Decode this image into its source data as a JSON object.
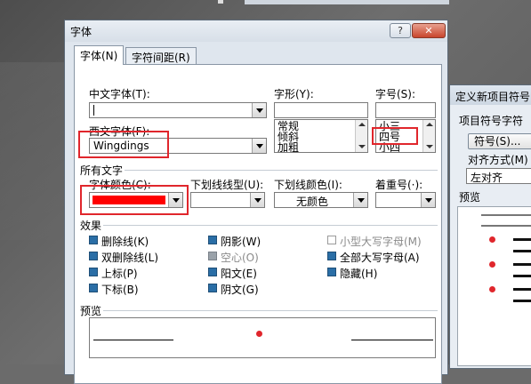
{
  "font_dialog": {
    "title": "字体",
    "buttons": {
      "help": "?",
      "close": "✕"
    },
    "tabs": [
      {
        "label": "字体(N)"
      },
      {
        "label": "字符间距(R)"
      }
    ],
    "chinese_font": {
      "label": "中文字体(T):",
      "value": ""
    },
    "western_font": {
      "label": "西文字体(F):",
      "value": "Wingdings"
    },
    "style": {
      "label": "字形(Y):",
      "value": "",
      "options": [
        "常规",
        "倾斜",
        "加粗"
      ]
    },
    "size": {
      "label": "字号(S):",
      "value": "",
      "options": [
        "小三",
        "四号",
        "小四"
      ]
    },
    "all_text": {
      "heading": "所有文字",
      "font_color": {
        "label": "字体颜色(C):",
        "color": "#ff0000"
      },
      "underline_style": {
        "label": "下划线线型(U):",
        "value": ""
      },
      "underline_color": {
        "label": "下划线颜色(I):",
        "value": "无颜色"
      },
      "emphasis": {
        "label": "着重号(·):",
        "value": ""
      }
    },
    "effects": {
      "heading": "效果",
      "items": [
        {
          "label": "删除线(K)"
        },
        {
          "label": "双删除线(L)"
        },
        {
          "label": "上标(P)"
        },
        {
          "label": "下标(B)"
        },
        {
          "label": "阴影(W)"
        },
        {
          "label": "空心(O)"
        },
        {
          "label": "阳文(E)"
        },
        {
          "label": "阴文(G)"
        },
        {
          "label": "小型大写字母(M)"
        },
        {
          "label": "全部大写字母(A)"
        },
        {
          "label": "隐藏(H)"
        }
      ]
    },
    "preview": {
      "heading": "预览",
      "symbol_color": "#e0262c"
    }
  },
  "bullet_dialog": {
    "title": "定义新项目符号",
    "section": "项目符号字符",
    "symbol_button": "符号(S)...",
    "alignment_label": "对齐方式(M)",
    "alignment_value": "左对齐",
    "preview_heading": "预览"
  },
  "colors": {
    "highlight": "#e0262c",
    "checkbox": "#2a6ea6"
  }
}
